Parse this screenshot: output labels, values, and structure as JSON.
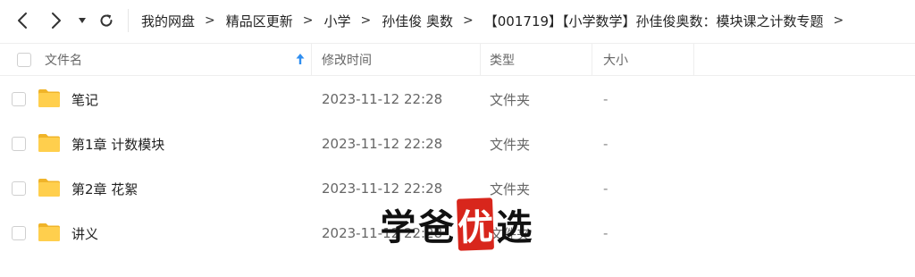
{
  "breadcrumb": [
    "我的网盘",
    "精品区更新",
    "小学",
    "孙佳俊 奥数",
    "【001719】【小学数学】孙佳俊奥数：模块课之计数专题"
  ],
  "breadcrumb_separator": ">",
  "columns": {
    "name": "文件名",
    "modified": "修改时间",
    "type": "类型",
    "size": "大小"
  },
  "rows": [
    {
      "name": "笔记",
      "modified": "2023-11-12 22:28",
      "type": "文件夹",
      "size": "-"
    },
    {
      "name": "第1章 计数模块",
      "modified": "2023-11-12 22:28",
      "type": "文件夹",
      "size": "-"
    },
    {
      "name": "第2章 花絮",
      "modified": "2023-11-12 22:28",
      "type": "文件夹",
      "size": "-"
    },
    {
      "name": "讲义",
      "modified": "2023-11-12 22:28",
      "type": "文件夹",
      "size": "-"
    }
  ],
  "watermark": {
    "chars": [
      "学",
      "爸",
      "优",
      "选"
    ],
    "highlight_color": "#d8261c"
  },
  "colors": {
    "folder": "#f9c53f",
    "sort_arrow": "#2f8ef0"
  }
}
